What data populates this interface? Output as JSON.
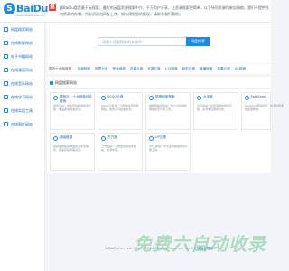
{
  "header": {
    "logo_mark": "S",
    "logo_text": "BaiDu",
    "logo_badge": "盘",
    "logo_sub": "www.sobaidupan.com",
    "description": "搜BaiDu盘是基于云搜索，最大的云盘资源搜索中介，千万用户分享，让资源搜索更简单，以下所列资源均来自网络，我们不提供任何资源的存储，所有资源由网友上传，如有侵犯您的版权，请联系我们删除。"
  },
  "sidebar": {
    "items": [
      {
        "label": "网盘搜索网站"
      },
      {
        "label": "在线影视网站"
      },
      {
        "label": "电子书籍网站"
      },
      {
        "label": "在线漫画网站"
      },
      {
        "label": "在线音乐网站"
      },
      {
        "label": "在线学习网站"
      },
      {
        "label": "在线实用工具"
      },
      {
        "label": "在线图片网站"
      }
    ]
  },
  "search": {
    "placeholder": "请输入您要搜索的关键字",
    "button_label": "网盘搜索"
  },
  "engines": {
    "label": "国内十大网盘搜：",
    "items": [
      "百度网盘",
      "阿里云盘",
      "夸克网盘",
      "迅雷云盘",
      "天翼云盘",
      "115网盘",
      "和彩云盘",
      "城通网盘",
      "蓝奏云盘",
      "UC网盘"
    ]
  },
  "cards": {
    "title": "网盘搜索网站",
    "items": [
      {
        "title": "搜阿云 - 十大网盘综合搜索",
        "desc": "搜阿云是一款免费的网盘搜索引擎，覆盖各类网盘资源。"
      },
      {
        "title": "SOSO云盘",
        "desc": "SOSO云盘是一个网盘资源搜索网站，免费分享各类资源。"
      },
      {
        "title": "猫狸网盘搜索",
        "desc": "猫狸网盘搜索是一款十分好用的网盘搜索引擎工具。"
      },
      {
        "title": "大圣盘",
        "desc": "大圣盘是一款百度网盘搜索引擎，资源丰富更新及时。"
      },
      {
        "title": "FastSoso",
        "desc": "FastSoso网盘搜索，资源搜索更快速更精准。"
      },
      {
        "title": "超级盘搜",
        "desc": "超级盘搜提供网盘资源搜索服务，极速获取所需资源。"
      },
      {
        "title": "万方盘",
        "desc": "万方盘是一个网盘资源搜索网站，资源丰富。"
      },
      {
        "title": "UP云搜",
        "desc": "UP云搜是一款专业的网盘搜索引擎工具。"
      }
    ]
  },
  "footer": {
    "text": "SoBaiDuPan.com 2019-2023 All Rights Reserved Ver 1.0 ",
    "link": "使用云搜索"
  },
  "watermark": "免费六自动收录"
}
